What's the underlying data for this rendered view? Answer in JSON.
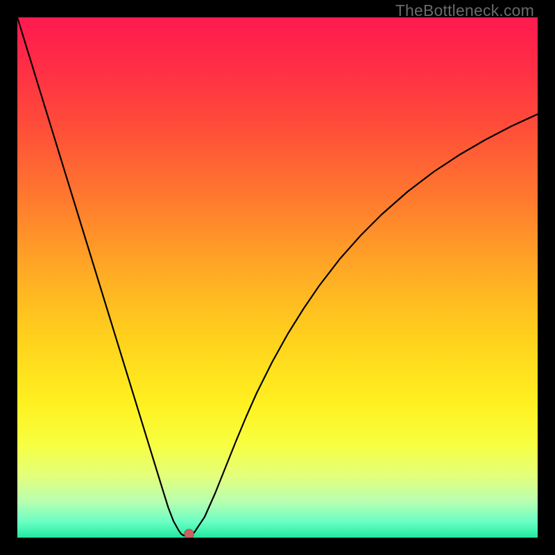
{
  "watermark": "TheBottleneck.com",
  "colors": {
    "background_frame": "#000000",
    "curve_stroke": "#000000",
    "marker_fill": "#cc6060",
    "gradient_stops": [
      {
        "offset": 0.0,
        "color": "#ff1a4f"
      },
      {
        "offset": 0.08,
        "color": "#ff2a47"
      },
      {
        "offset": 0.2,
        "color": "#ff4a3a"
      },
      {
        "offset": 0.35,
        "color": "#ff7a2e"
      },
      {
        "offset": 0.5,
        "color": "#ffae24"
      },
      {
        "offset": 0.62,
        "color": "#ffd21c"
      },
      {
        "offset": 0.74,
        "color": "#fff020"
      },
      {
        "offset": 0.82,
        "color": "#f7ff40"
      },
      {
        "offset": 0.88,
        "color": "#e4ff7a"
      },
      {
        "offset": 0.93,
        "color": "#b8ffb0"
      },
      {
        "offset": 0.97,
        "color": "#6affc4"
      },
      {
        "offset": 1.0,
        "color": "#20e8a0"
      }
    ]
  },
  "chart_data": {
    "type": "line",
    "title": "",
    "xlabel": "",
    "ylabel": "",
    "xlim": [
      0,
      100
    ],
    "ylim": [
      0,
      100
    ],
    "note": "V-shaped bottleneck curve. y ≈ 100 means high bottleneck (red), y ≈ 0 means no bottleneck (green). Minimum near x ≈ 32.",
    "x": [
      0,
      2,
      4,
      6,
      8,
      10,
      12,
      14,
      16,
      18,
      20,
      22,
      24,
      26,
      28,
      29,
      30,
      31,
      31.5,
      32,
      32.5,
      33,
      34,
      36,
      38,
      40,
      42,
      44,
      46,
      49,
      52,
      55,
      58,
      62,
      66,
      70,
      75,
      80,
      85,
      90,
      95,
      100
    ],
    "y": [
      100,
      93.5,
      87,
      80.5,
      74,
      67.5,
      61,
      54.5,
      48,
      41.5,
      35,
      28.5,
      22,
      15.5,
      9,
      5.8,
      3.2,
      1.4,
      0.7,
      0.4,
      0.4,
      0.5,
      1.0,
      4.0,
      8.5,
      13.5,
      18.5,
      23.3,
      27.8,
      33.8,
      39.2,
      44.0,
      48.4,
      53.6,
      58.1,
      62.1,
      66.5,
      70.3,
      73.6,
      76.5,
      79.1,
      81.4
    ],
    "marker": {
      "x": 33.0,
      "y": 0.7
    }
  }
}
